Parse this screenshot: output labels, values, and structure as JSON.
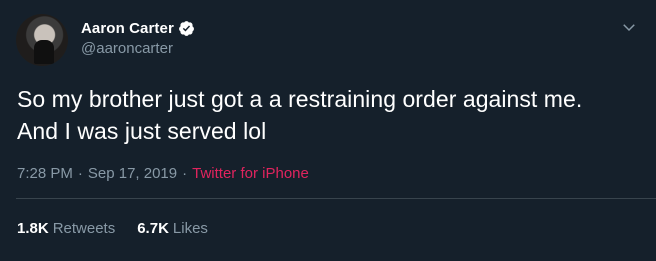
{
  "author": {
    "display_name": "Aaron Carter",
    "handle": "@aaroncarter",
    "verified": true
  },
  "tweet": {
    "text": "So my brother just got a a restraining order against me.\nAnd I was just served lol",
    "time": "7:28 PM",
    "separator": "·",
    "date": "Sep 17, 2019",
    "source": "Twitter for iPhone"
  },
  "stats": {
    "retweets_count": "1.8K",
    "retweets_label": "Retweets",
    "likes_count": "6.7K",
    "likes_label": "Likes"
  },
  "icons": {
    "verified": "verified-badge-icon",
    "menu": "chevron-down-icon"
  },
  "colors": {
    "background": "#15202b",
    "text_primary": "#ffffff",
    "text_secondary": "#8899a6",
    "source_link": "#e0245e",
    "divider": "#38444d"
  }
}
